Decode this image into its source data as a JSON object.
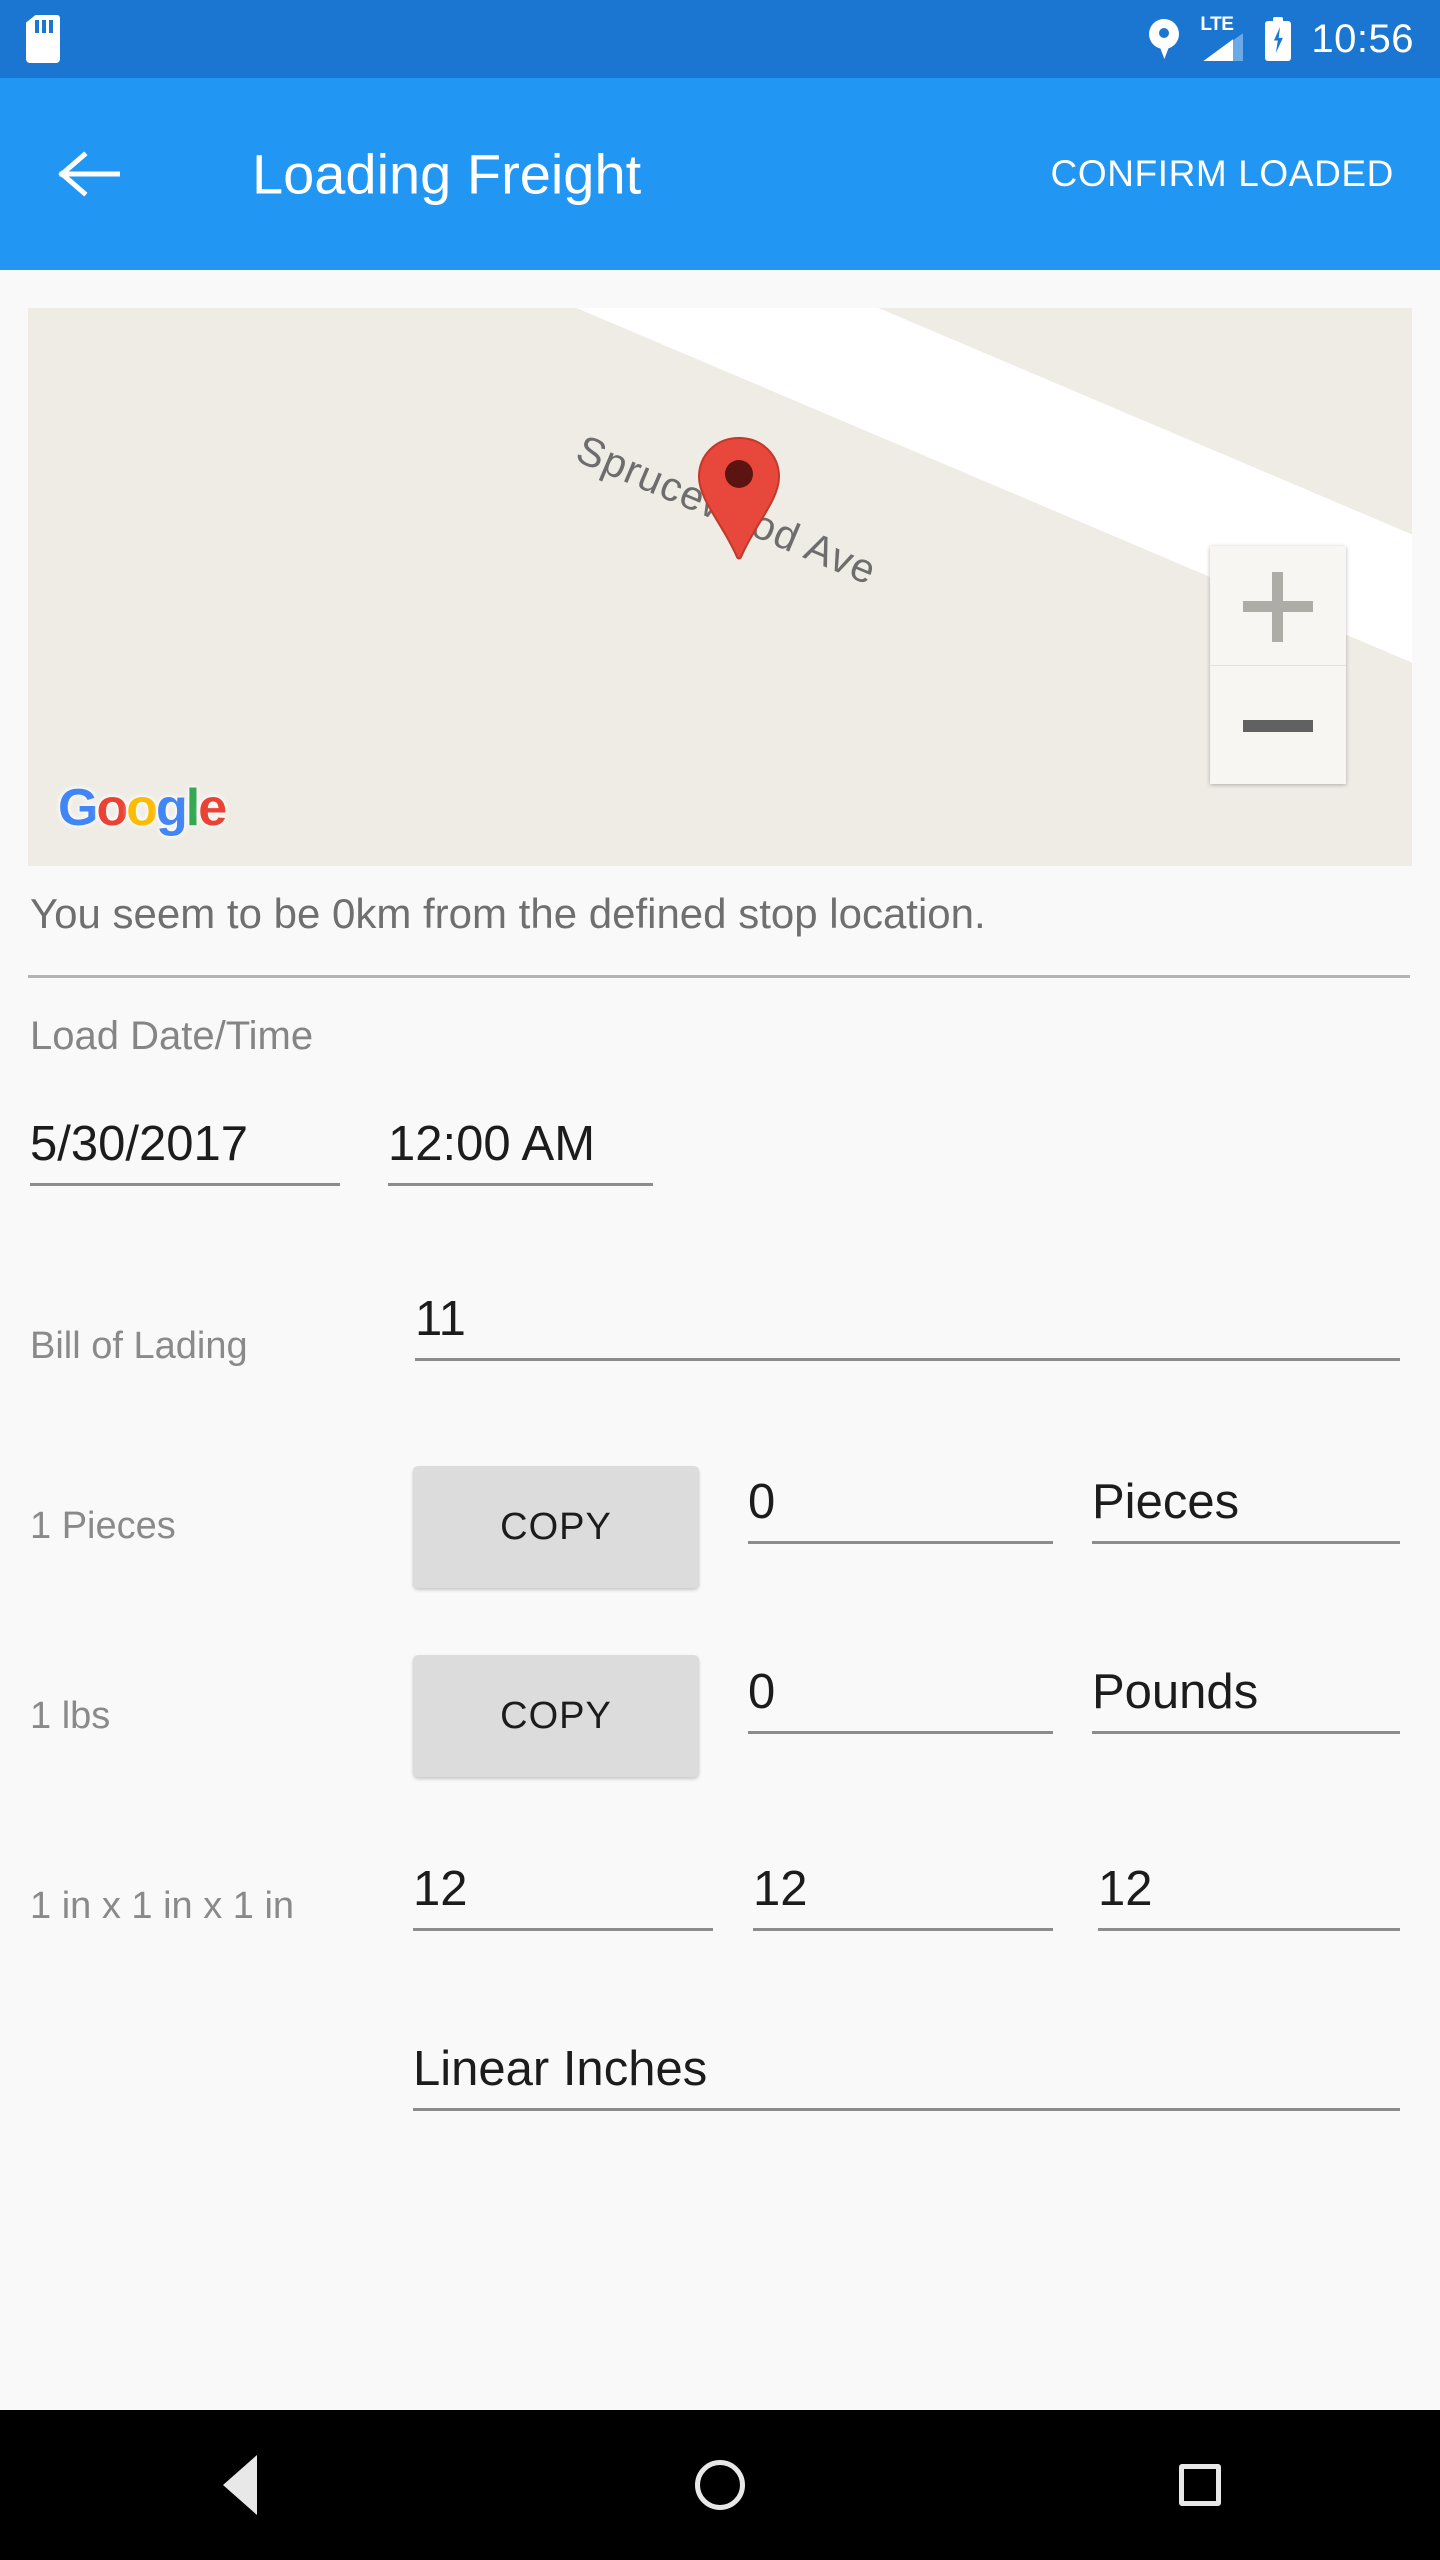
{
  "statusbar": {
    "time": "10:56",
    "icons": [
      "sd-card-icon",
      "location-pin-icon",
      "lte-signal-icon",
      "battery-charging-icon"
    ],
    "signal_label": "LTE",
    "background": "#1b76d2"
  },
  "appbar": {
    "back_label": "back-arrow-icon",
    "title": "Loading Freight",
    "action_label": "CONFIRM LOADED",
    "background": "#2196f3"
  },
  "map": {
    "street_name": "Sprucewood Ave",
    "attribution": "Google",
    "attribution_letters": [
      "G",
      "o",
      "o",
      "g",
      "l",
      "e"
    ],
    "marker": "map-pin-marker",
    "zoom_in_label": "+",
    "zoom_out_label": "−",
    "background": "#efece5",
    "road_color": "#ffffff"
  },
  "form": {
    "distance_hint": "You seem to be 0km from the defined stop location.",
    "section_label": "Load Date/Time",
    "date_value": "5/30/2017",
    "time_value": "12:00 AM",
    "bill_of_lading": {
      "label": "Bill of Lading",
      "value": "11"
    },
    "pieces_row": {
      "label": "1 Pieces",
      "copy_label": "COPY",
      "count_value": "0",
      "unit_value": "Pieces"
    },
    "weight_row": {
      "label": "1 lbs",
      "copy_label": "COPY",
      "count_value": "0",
      "unit_value": "Pounds"
    },
    "dimensions_row": {
      "label": "1 in x 1 in x 1 in",
      "length_value": "12",
      "width_value": "12",
      "height_value": "12"
    },
    "linear_inches": {
      "value": "Linear Inches"
    }
  },
  "navbar": {
    "back": "nav-back-icon",
    "home": "nav-home-icon",
    "recents": "nav-recents-icon"
  }
}
